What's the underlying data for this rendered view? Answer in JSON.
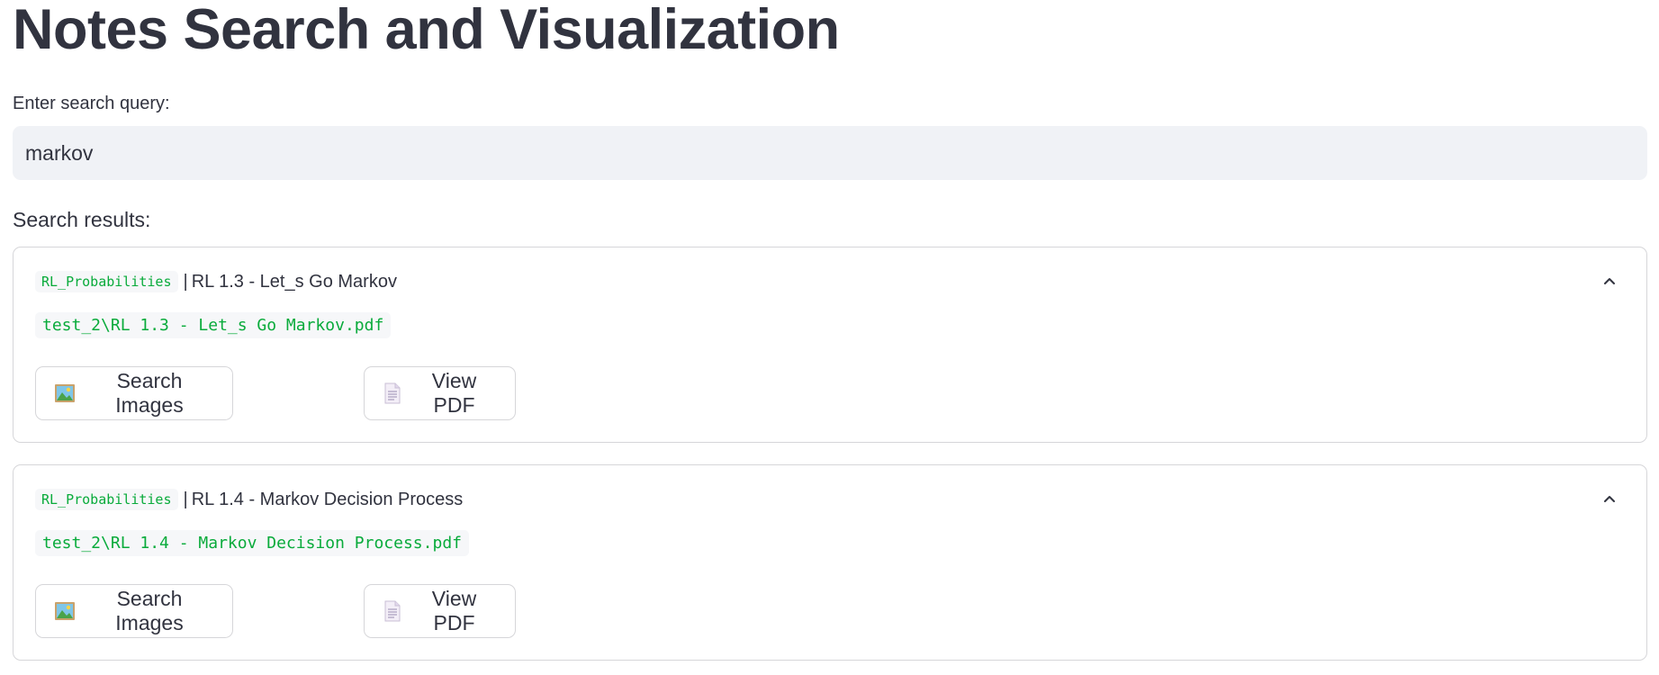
{
  "page": {
    "title": "Notes Search and Visualization",
    "query_label": "Enter search query:",
    "query_value": "markov",
    "results_label": "Search results:"
  },
  "results": [
    {
      "tag": "RL_Probabilities",
      "separator": "|",
      "title": "RL 1.3 - Let_s Go Markov",
      "path": "test_2\\RL 1.3 - Let_s Go Markov.pdf",
      "expanded": true,
      "search_images_label": "Search Images",
      "view_pdf_label": "View PDF",
      "search_images_icon": "framed-picture-icon",
      "view_pdf_icon": "page-icon",
      "chevron_icon": "chevron-up-icon"
    },
    {
      "tag": "RL_Probabilities",
      "separator": "|",
      "title": "RL 1.4 - Markov Decision Process",
      "path": "test_2\\RL 1.4 - Markov Decision Process.pdf",
      "expanded": true,
      "search_images_label": "Search Images",
      "view_pdf_label": "View PDF",
      "search_images_icon": "framed-picture-icon",
      "view_pdf_icon": "page-icon",
      "chevron_icon": "chevron-up-icon"
    }
  ],
  "colors": {
    "text": "#31333f",
    "code_green": "#09ab3b",
    "input_bg": "#f0f2f6",
    "border": "#d6d6d9"
  }
}
